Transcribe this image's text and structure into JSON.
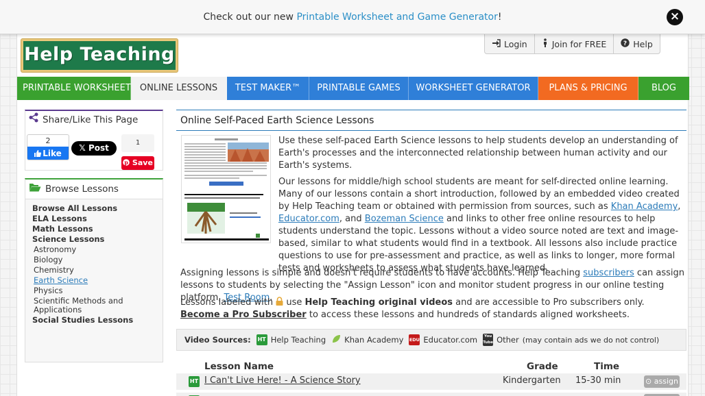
{
  "banner": {
    "text_before": "Check out our new ",
    "link": "Printable Worksheet and Game Generator",
    "text_after": "!"
  },
  "logo": {
    "text": "Help Teaching"
  },
  "userbar": {
    "login": "Login",
    "join": "Join for FREE",
    "help": "Help"
  },
  "nav": [
    {
      "label": "PRINTABLE WORKSHEETS",
      "color": "#3aa12f"
    },
    {
      "label": "ONLINE LESSONS",
      "color": "#f2f2f2"
    },
    {
      "label": "TEST MAKER™",
      "color": "#2f7fd8"
    },
    {
      "label": "PRINTABLE GAMES",
      "color": "#2f7fd8"
    },
    {
      "label": "WORKSHEET GENERATOR",
      "color": "#2f7fd8"
    },
    {
      "label": "PLANS & PRICING",
      "color": "#f26a21"
    },
    {
      "label": "BLOG",
      "color": "#3aa12f"
    }
  ],
  "share": {
    "title": "Share/Like This Page",
    "fb_count": "2",
    "fb_like": "Like",
    "tweet": "Post",
    "pin_count": "1",
    "pin_save": "Save"
  },
  "browse": {
    "title": "Browse Lessons",
    "items": [
      {
        "label": "Browse All Lessons",
        "kind": "main"
      },
      {
        "label": "ELA Lessons",
        "kind": "main"
      },
      {
        "label": "Math Lessons",
        "kind": "main"
      },
      {
        "label": "Science Lessons",
        "kind": "main"
      },
      {
        "label": "Astronomy",
        "kind": "sub"
      },
      {
        "label": "Biology",
        "kind": "sub"
      },
      {
        "label": "Chemistry",
        "kind": "sub"
      },
      {
        "label": "Earth Science",
        "kind": "active"
      },
      {
        "label": "Physics",
        "kind": "sub"
      },
      {
        "label": "Scientific Methods and Applications",
        "kind": "wrap"
      },
      {
        "label": "Social Studies Lessons",
        "kind": "main"
      }
    ]
  },
  "main": {
    "title": "Online Self-Paced Earth Science Lessons",
    "p1": "Use these self-paced Earth Science lessons to help students develop an understanding of Earth's processes and the interconnected relationship between human activity and our Earth's systems.",
    "p2_a": "Our lessons for middle/high school students are meant for self-directed online learning. Many of our lessons contain a short introduction, followed by an embedded video created by Help Teaching team or obtained with permission from sources, such as ",
    "p2_link1": "Khan Academy",
    "p2_sep1": ", ",
    "p2_link2": "Educator.com",
    "p2_sep2": ", and ",
    "p2_link3": "Bozeman Science",
    "p2_b": " and links to other free online resources to help students understand the topic. Lessons without a video source noted are text and image-based, similar to what students would find in a textbook. All lessons also include practice questions to use for pre-assessment and practice, as well as links to longer, more formal tests and worksheets to assess what students have learned.",
    "p3_a": "Assigning lessons is simple and doesn't require students to have accounts. Help Teaching ",
    "p3_link1": "subscribers",
    "p3_b": " can assign lessons to students by selecting the \"Assign Lesson\" icon and monitor student progress in our online testing platform, ",
    "p3_link2": "Test Room",
    "p3_c": ".",
    "p4_a": "Lessons labeled with ",
    "p4_b": " use ",
    "p4_bold": "Help Teaching original videos",
    "p4_c": " and are accessible to Pro subscribers only. ",
    "p4_link": "Become a Pro Subscriber",
    "p4_d": " to access these lessons and hundreds of standards aligned worksheets."
  },
  "sources": {
    "label": "Video Sources:",
    "items": [
      {
        "icon": "help-teaching-icon",
        "badge": "HT",
        "label": "Help Teaching"
      },
      {
        "icon": "khan-academy-icon",
        "badge": "",
        "label": "Khan Academy"
      },
      {
        "icon": "educator-icon",
        "badge": "EDU",
        "label": "Educator.com"
      },
      {
        "icon": "youtube-icon",
        "badge": "You Tube",
        "label": "Other"
      }
    ],
    "note": "(may contain ads we do not control)"
  },
  "lessons": {
    "headers": {
      "name": "Lesson Name",
      "grade": "Grade",
      "time": "Time"
    },
    "rows": [
      {
        "badge": "HT",
        "name": "I Can't Live Here! - A Science Story",
        "grade": "Kindergarten",
        "time": "15-30 min",
        "action": "assign"
      }
    ]
  }
}
